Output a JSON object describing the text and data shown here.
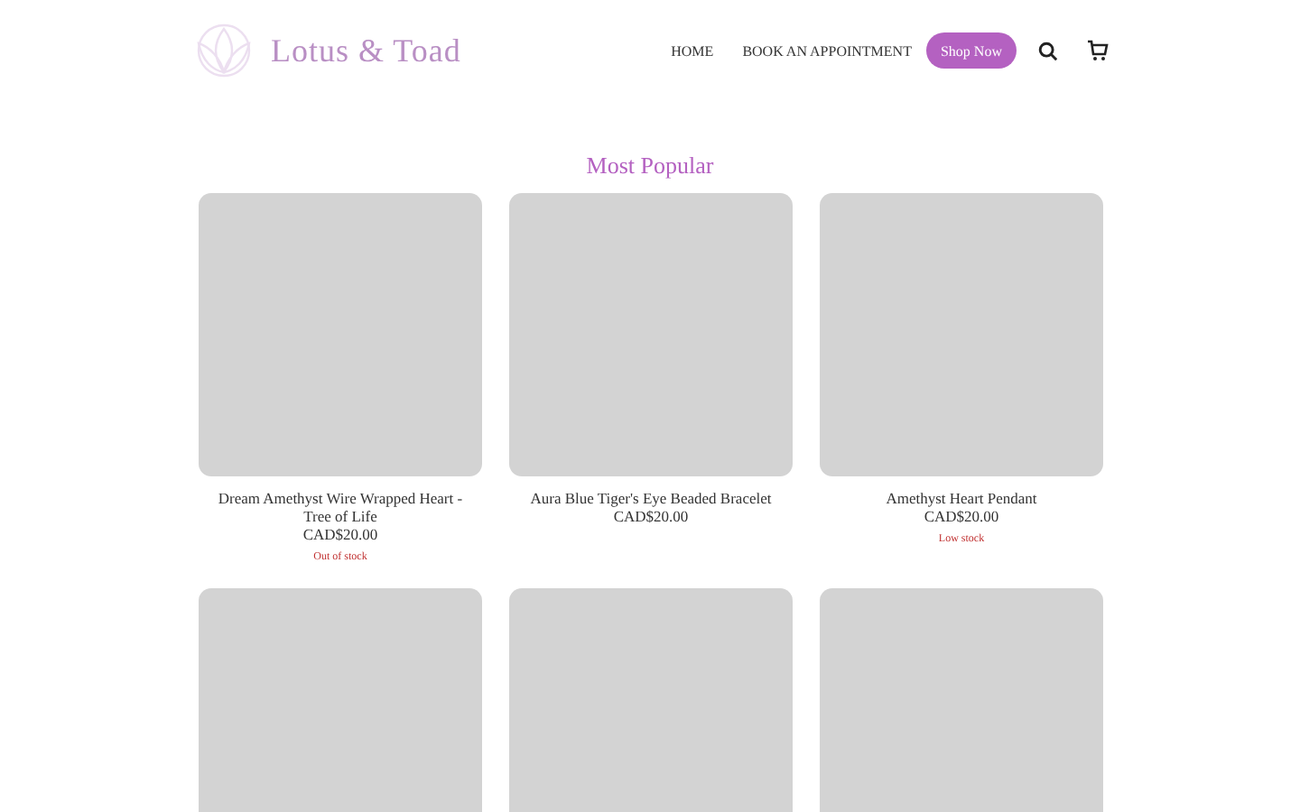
{
  "header": {
    "logo": "Lotus & Toad",
    "nav": [
      "HOME",
      "BOOK AN APPOINTMENT"
    ],
    "cta": "Shop Now"
  },
  "section": {
    "title": "Most Popular"
  },
  "products": [
    {
      "kind": "picture",
      "name": "Dream Amethyst Wire Wrapped Heart - Tree of Life",
      "price": "CAD$20.00",
      "stock": "Out of stock"
    },
    {
      "kind": "picture",
      "name": "Aura Blue Tiger's Eye Beaded Bracelet",
      "price": "CAD$20.00"
    },
    {
      "kind": "picture",
      "name": "Amethyst Heart Pendant",
      "price": "CAD$20.00",
      "stock": "Low stock"
    },
    {
      "kind": "picture"
    },
    {
      "kind": "picture"
    },
    {
      "kind": "picture"
    }
  ]
}
